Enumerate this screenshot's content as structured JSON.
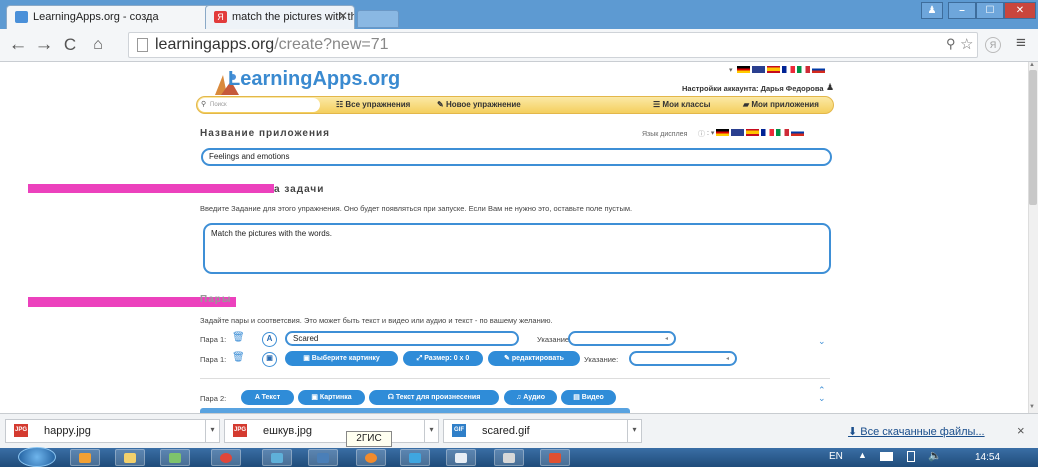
{
  "browser": {
    "tabs": [
      {
        "title": "LearningApps.org - созда",
        "active": true
      },
      {
        "title": "match the pictures with th",
        "active": false
      }
    ],
    "url_host": "learningapps.org",
    "url_path": "/create?new=71",
    "window_buttons": [
      "⎯",
      "☐",
      "✕"
    ]
  },
  "site": {
    "logo": "LearningApps.org",
    "account_label": "Настройки аккаунта: Дарья Федорова",
    "search_placeholder": "Поиск",
    "nav": {
      "all_exercises": "Все упражнения",
      "new_exercise": "Новое упражнение",
      "my_classes": "Мои классы",
      "my_apps": "Мои приложения"
    },
    "display_language": "Язык дисплея"
  },
  "form": {
    "app_name_heading": "Название приложения",
    "app_name_value": "Feelings and emotions",
    "task_heading_suffix": "а задачи",
    "task_description": "Введите Задание для этого упражнения. Оно будет появляться при запуске. Если Вам не нужно это, оставьте поле пустым.",
    "task_value": "Match the pictures with the words.",
    "pairs_heading": "Пары",
    "pairs_description": "Задайте пары и соответсвия. Это может быть текст и видео или аудио и текст - по вашему желанию.",
    "pair1_label": "Пара 1:",
    "pair1_text_value": "Scared",
    "hint_label": "Указание:",
    "pair1b_label": "Пара 1:",
    "btn_choose_picture": "Выберите картинку",
    "btn_size": "Размер: 0 x 0",
    "btn_edit": "редактировать",
    "hint_label2": "Указание:",
    "pair2_label": "Пара 2:",
    "pair2_buttons": [
      "Текст",
      "Картинка",
      "Текст для произнесения",
      "Аудио",
      "Видео"
    ]
  },
  "downloads": {
    "items": [
      {
        "name": "happy.jpg",
        "type": "JPG"
      },
      {
        "name": "ешкув.jpg",
        "type": "JPG"
      },
      {
        "name": "scared.gif",
        "type": "GIF"
      }
    ],
    "tooltip": "2ГИС",
    "all_downloads": "Все скачанные файлы...",
    "close": "×"
  },
  "taskbar": {
    "lang": "EN",
    "time": "14:54"
  }
}
